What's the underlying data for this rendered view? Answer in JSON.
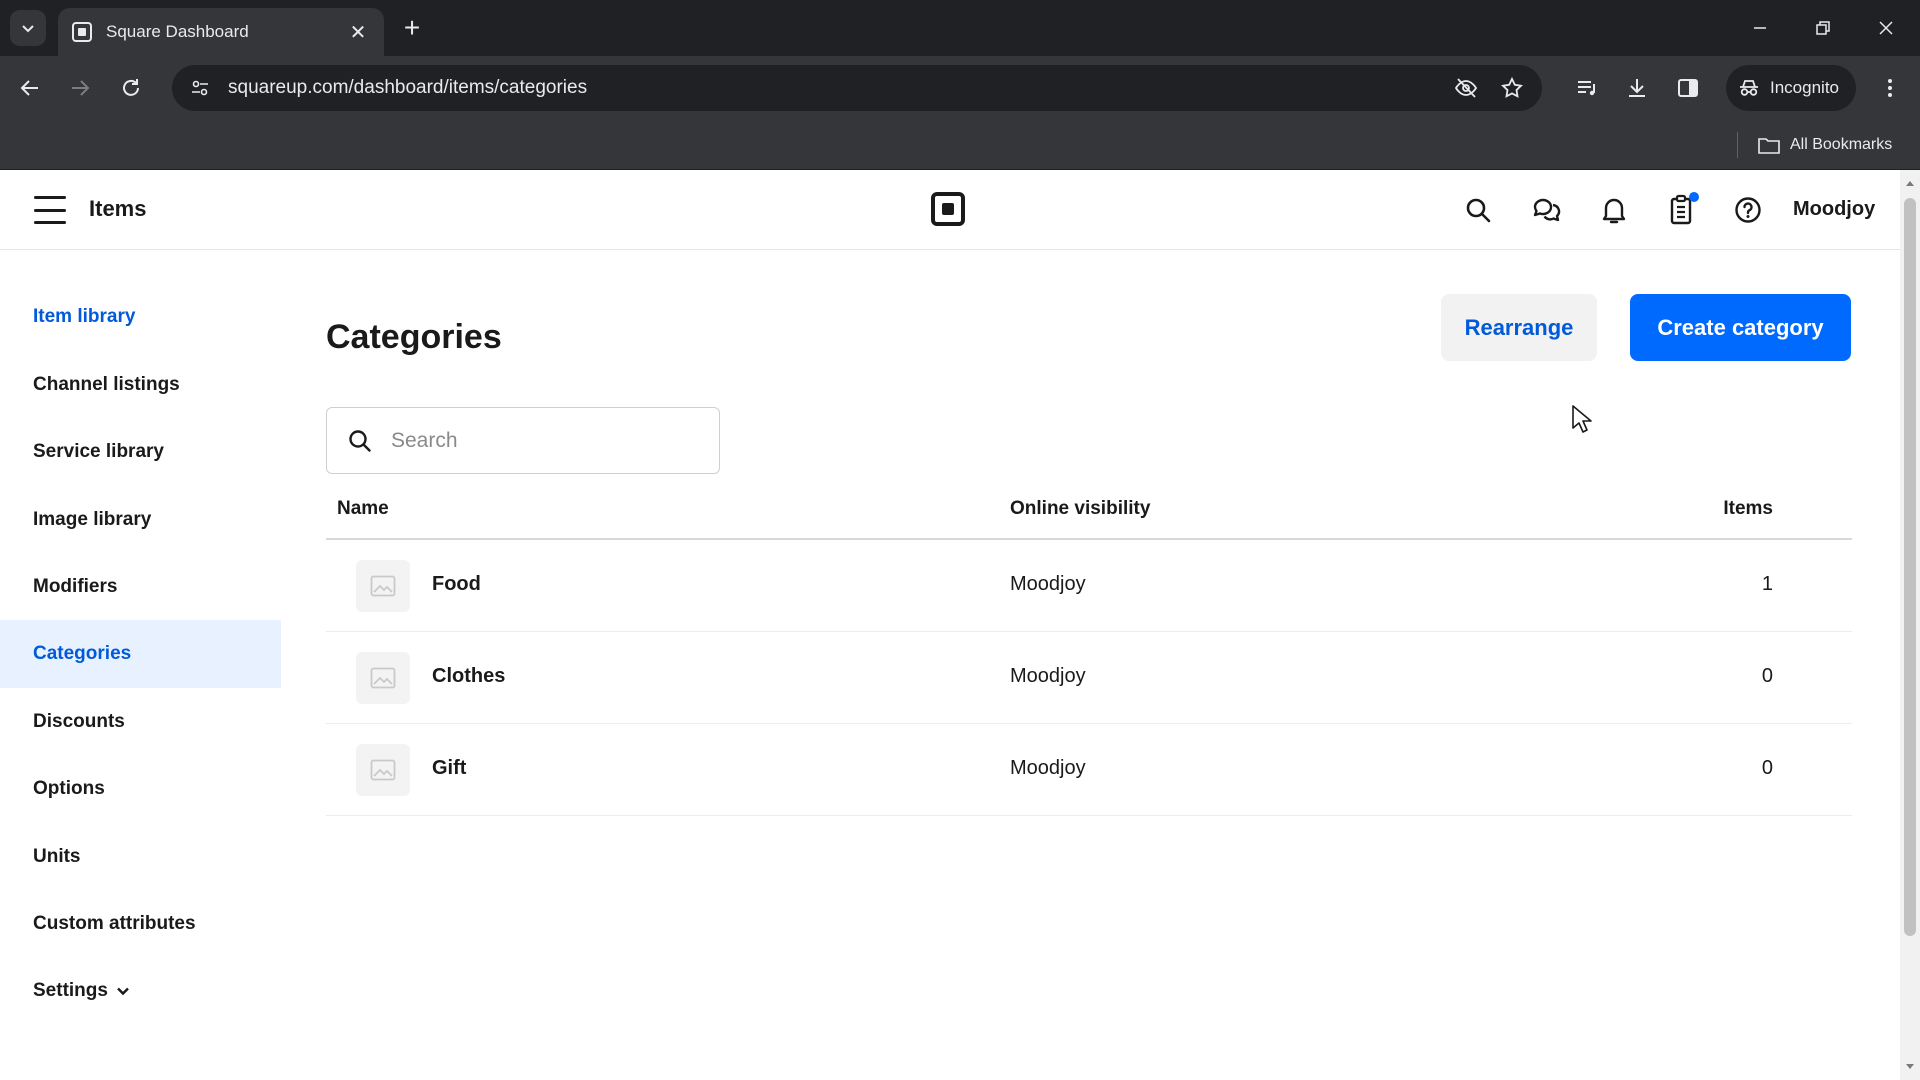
{
  "browser": {
    "tab_title": "Square Dashboard",
    "tab_close": "✕",
    "new_tab": "+",
    "url": "squareup.com/dashboard/items/categories",
    "incognito_label": "Incognito",
    "all_bookmarks": "All Bookmarks"
  },
  "header": {
    "title": "Items",
    "account": "Moodjoy"
  },
  "sidebar": {
    "items": [
      {
        "label": "Item library"
      },
      {
        "label": "Channel listings"
      },
      {
        "label": "Service library"
      },
      {
        "label": "Image library"
      },
      {
        "label": "Modifiers"
      },
      {
        "label": "Categories"
      },
      {
        "label": "Discounts"
      },
      {
        "label": "Options"
      },
      {
        "label": "Units"
      },
      {
        "label": "Custom attributes"
      },
      {
        "label": "Settings"
      }
    ],
    "active": "Categories"
  },
  "main": {
    "title": "Categories",
    "rearrange_label": "Rearrange",
    "create_label": "Create category",
    "search_placeholder": "Search",
    "columns": {
      "name": "Name",
      "visibility": "Online visibility",
      "items": "Items"
    },
    "rows": [
      {
        "name": "Food",
        "visibility": "Moodjoy",
        "items": "1"
      },
      {
        "name": "Clothes",
        "visibility": "Moodjoy",
        "items": "0"
      },
      {
        "name": "Gift",
        "visibility": "Moodjoy",
        "items": "0"
      }
    ]
  },
  "colors": {
    "accent": "#006aff",
    "link": "#005ad9",
    "active_bg": "#e8f1ff"
  },
  "icons": {
    "header": [
      "search-icon",
      "messages-icon",
      "bell-icon",
      "clipboard-icon",
      "help-icon"
    ],
    "row_thumbnail": "image-placeholder-icon"
  }
}
